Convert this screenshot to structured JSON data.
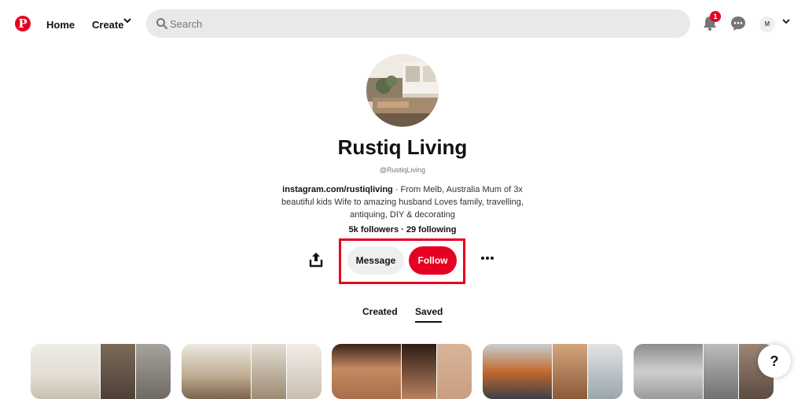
{
  "nav": {
    "logo": "P",
    "home": "Home",
    "create": "Create",
    "create_chevron": "❯"
  },
  "search": {
    "placeholder": "Search"
  },
  "header": {
    "notification_count": "1",
    "account_initial": "M"
  },
  "profile": {
    "name": "Rustiq Living",
    "handle": "@RustiqLiving",
    "bio_link": "instagram.com/rustiqliving",
    "bio_text": " · From Melb, Australia Mum of 3x beautiful kids Wife to amazing husband Loves family, travelling, antiquing, DIY & decorating",
    "stats": "5k followers · 29 following"
  },
  "actions": {
    "message": "Message",
    "follow": "Follow"
  },
  "tabs": {
    "created": "Created",
    "saved": "Saved",
    "active": "Saved"
  },
  "help": {
    "label": "?"
  },
  "colors": {
    "brand": "#e60023",
    "highlight": "#e60023"
  }
}
